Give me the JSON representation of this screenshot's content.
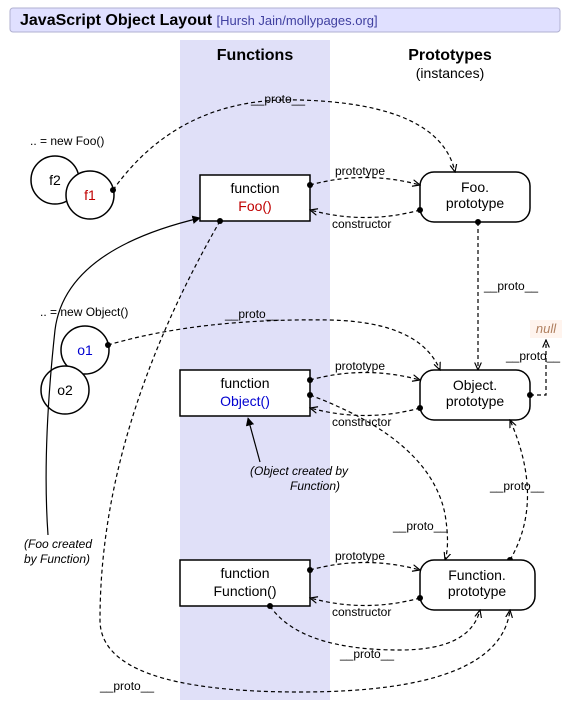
{
  "header": {
    "title": "JavaScript Object Layout",
    "attribution": "[Hursh Jain/mollypages.org]"
  },
  "columns": {
    "left": "Functions",
    "right": "Prototypes",
    "right_sub": "(instances)"
  },
  "instances": {
    "foo_new": ".. = new Foo()",
    "f1": "f1",
    "f2": "f2",
    "obj_new": ".. = new Object()",
    "o1": "o1",
    "o2": "o2"
  },
  "functions": {
    "foo_kw": "function",
    "foo_name": "Foo()",
    "obj_kw": "function",
    "obj_name": "Object()",
    "fun_kw": "function",
    "fun_name": "Function()"
  },
  "prototypes": {
    "foo_p1": "Foo.",
    "foo_p2": "prototype",
    "obj_p1": "Object.",
    "obj_p2": "prototype",
    "fun_p1": "Function.",
    "fun_p2": "prototype"
  },
  "labels": {
    "proto": "__proto__",
    "prototype": "prototype",
    "constructor": "constructor",
    "null": "null"
  },
  "notes": {
    "obj_by_fun1": "(Object created by",
    "obj_by_fun2": "Function)",
    "foo_by_fun1": "(Foo created",
    "foo_by_fun2": "by Function)"
  }
}
